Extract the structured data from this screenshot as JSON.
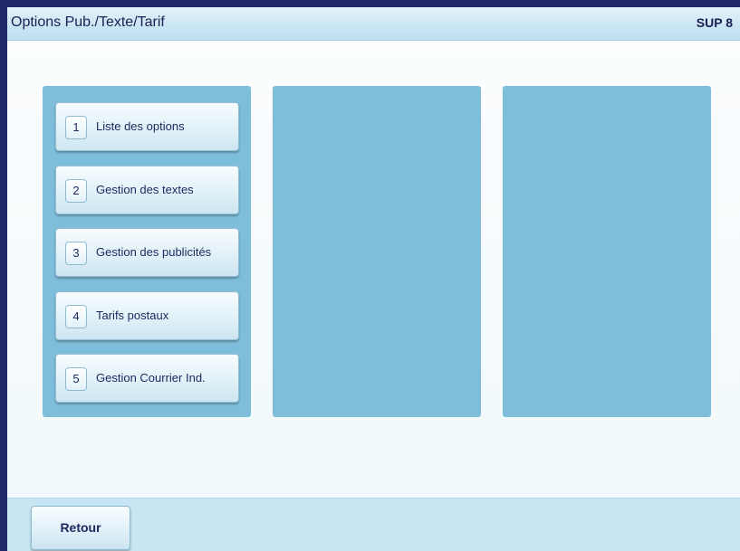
{
  "header": {
    "title": "Options Pub./Texte/Tarif",
    "screen_code": "SUP 8"
  },
  "menu": [
    {
      "number": "1",
      "label": "Liste des options"
    },
    {
      "number": "2",
      "label": "Gestion des textes"
    },
    {
      "number": "3",
      "label": "Gestion des publicités"
    },
    {
      "number": "4",
      "label": "Tarifs postaux"
    },
    {
      "number": "5",
      "label": "Gestion Courrier Ind."
    }
  ],
  "footer": {
    "back_label": "Retour"
  },
  "colors": {
    "frame": "#22286a",
    "panel": "#7fbedb",
    "title_bar": "#cbe6f3",
    "footer": "#c7e5f2",
    "text": "#1d2960"
  }
}
